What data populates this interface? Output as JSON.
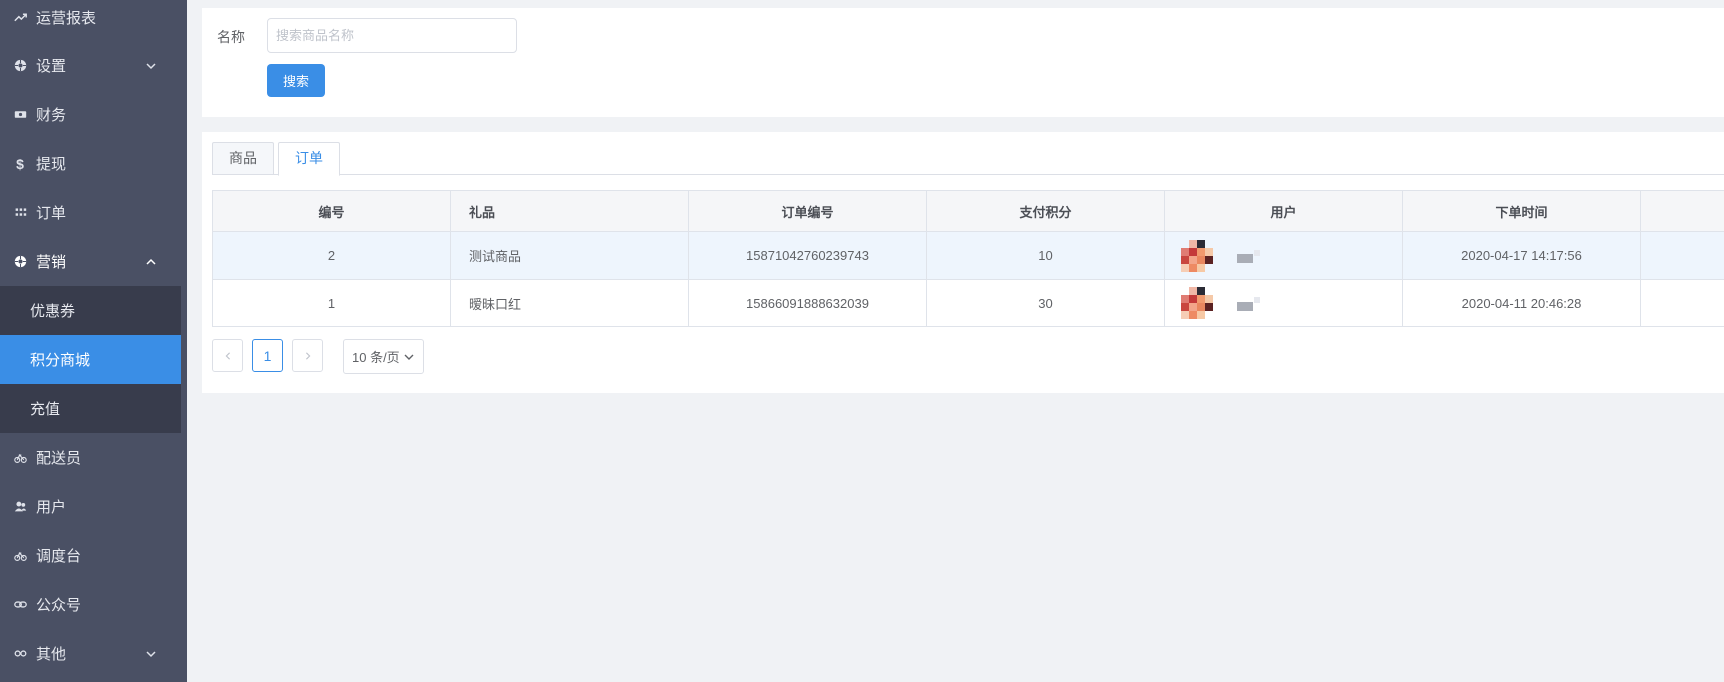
{
  "sidebar": {
    "items": [
      {
        "label": "运营报表",
        "icon": "trend-icon"
      },
      {
        "label": "设置",
        "icon": "settings-icon"
      },
      {
        "label": "财务",
        "icon": "money-icon"
      },
      {
        "label": "提现",
        "icon": "dollar-icon"
      },
      {
        "label": "订单",
        "icon": "grid-icon"
      },
      {
        "label": "营销",
        "icon": "marketing-icon"
      },
      {
        "label": "配送员",
        "icon": "bike-icon"
      },
      {
        "label": "用户",
        "icon": "users-icon"
      },
      {
        "label": "调度台",
        "icon": "bike-icon"
      },
      {
        "label": "公众号",
        "icon": "link-icon"
      },
      {
        "label": "其他",
        "icon": "other-icon"
      }
    ],
    "marketing_sub": [
      {
        "label": "优惠券"
      },
      {
        "label": "积分商城"
      },
      {
        "label": "充值"
      }
    ]
  },
  "search": {
    "label": "名称",
    "placeholder": "搜索商品名称",
    "button": "搜索"
  },
  "tabs": [
    {
      "label": "商品"
    },
    {
      "label": "订单"
    }
  ],
  "table": {
    "columns": [
      "编号",
      "礼品",
      "订单编号",
      "支付积分",
      "用户",
      "下单时间"
    ],
    "rows": [
      {
        "id": "2",
        "gift": "测试商品",
        "order_no": "15871042760239743",
        "points": "10",
        "time": "2020-04-17 14:17:56"
      },
      {
        "id": "1",
        "gift": "暧昧口红",
        "order_no": "15866091888632039",
        "points": "30",
        "time": "2020-04-11 20:46:28"
      }
    ]
  },
  "pagination": {
    "current": "1",
    "page_size": "10 条/页"
  },
  "colors": {
    "sidebar_bg": "#4a5064",
    "submenu_bg": "#383c4c",
    "accent": "#3a8ee6"
  }
}
